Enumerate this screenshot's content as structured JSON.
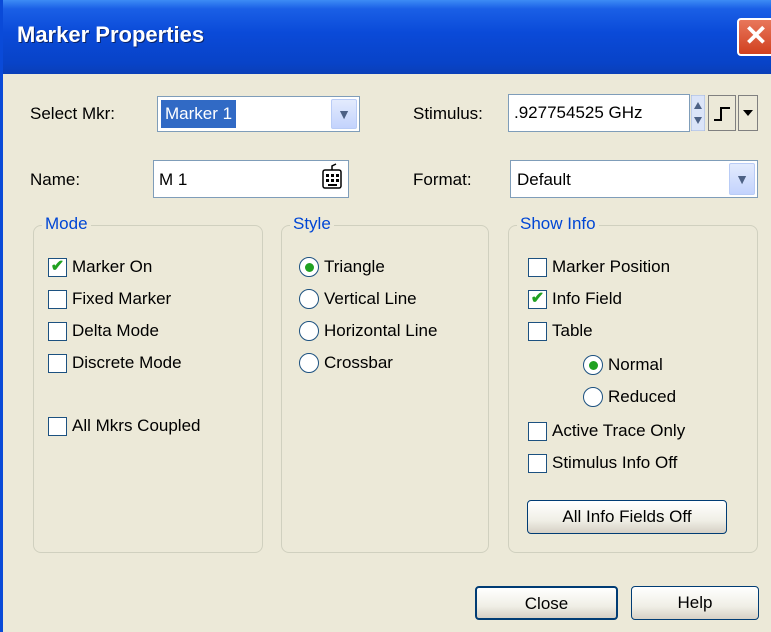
{
  "window": {
    "title": "Marker Properties",
    "close_symbol": "✕"
  },
  "select_mkr": {
    "label": "Select Mkr:",
    "value": "Marker 1"
  },
  "stimulus": {
    "label": "Stimulus:",
    "value": ".927754525 GHz"
  },
  "name": {
    "label": "Name:",
    "value": "M 1"
  },
  "format": {
    "label": "Format:",
    "value": "Default"
  },
  "mode": {
    "title": "Mode",
    "items": [
      {
        "label": "Marker On",
        "checked": true
      },
      {
        "label": "Fixed Marker",
        "checked": false
      },
      {
        "label": "Delta Mode",
        "checked": false
      },
      {
        "label": "Discrete Mode",
        "checked": false
      }
    ],
    "coupled": {
      "label": "All Mkrs Coupled",
      "checked": false
    }
  },
  "style": {
    "title": "Style",
    "options": [
      {
        "label": "Triangle",
        "selected": true
      },
      {
        "label": "Vertical Line",
        "selected": false
      },
      {
        "label": "Horizontal Line",
        "selected": false
      },
      {
        "label": "Crossbar",
        "selected": false
      }
    ]
  },
  "show_info": {
    "title": "Show Info",
    "marker_position": {
      "label": "Marker Position",
      "checked": false
    },
    "info_field": {
      "label": "Info Field",
      "checked": true
    },
    "table": {
      "label": "Table",
      "checked": false
    },
    "table_modes": [
      {
        "label": "Normal",
        "selected": true
      },
      {
        "label": "Reduced",
        "selected": false
      }
    ],
    "active_trace_only": {
      "label": "Active Trace Only",
      "checked": false
    },
    "stimulus_info_off": {
      "label": "Stimulus Info Off",
      "checked": false
    },
    "all_off_button": "All Info Fields Off"
  },
  "buttons": {
    "close": "Close",
    "help": "Help"
  },
  "colors": {
    "title_bar": "#0a4ad8",
    "group_title": "#0046d5",
    "check": "#21a121",
    "face": "#ece9d8"
  }
}
